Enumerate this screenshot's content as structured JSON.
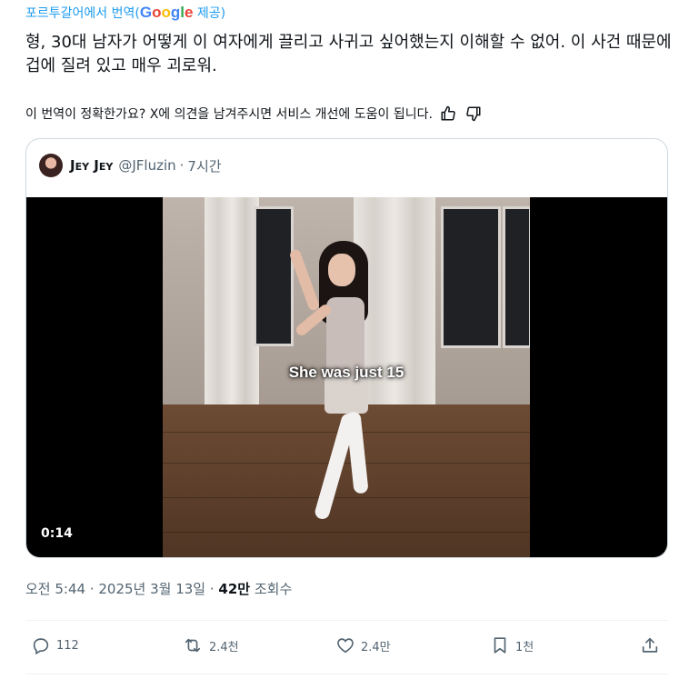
{
  "translation": {
    "translated_from": "포르투갈어에서 번역(",
    "google": "Google",
    "provided": " 제공)"
  },
  "tweet": {
    "text": "형, 30대 남자가 어떻게 이 여자에게 끌리고 사귀고 싶어했는지 이해할 수 없어. 이 사건 때문에 겁에 질려 있고 매우 괴로워."
  },
  "feedback": {
    "question": "이 번역이 정확한가요? X에 의견을 남겨주시면 서비스 개선에 도움이 됩니다."
  },
  "quote": {
    "name": "Jey Jey",
    "handle": "@JFluzin",
    "separator": "·",
    "time": "7시간",
    "video": {
      "caption": "She was just 15",
      "duration": "0:14"
    }
  },
  "meta": {
    "time": "오전 5:44 · 2025년 3월 13일 · ",
    "views_count": "42만",
    "views_label": " 조회수"
  },
  "actions": {
    "replies": "112",
    "reposts": "2.4천",
    "likes": "2.4만",
    "bookmarks": "1천"
  },
  "colors": {
    "accent": "#1d9bf0",
    "text": "#0f1419",
    "muted": "#536471",
    "border": "#cfd9de"
  }
}
